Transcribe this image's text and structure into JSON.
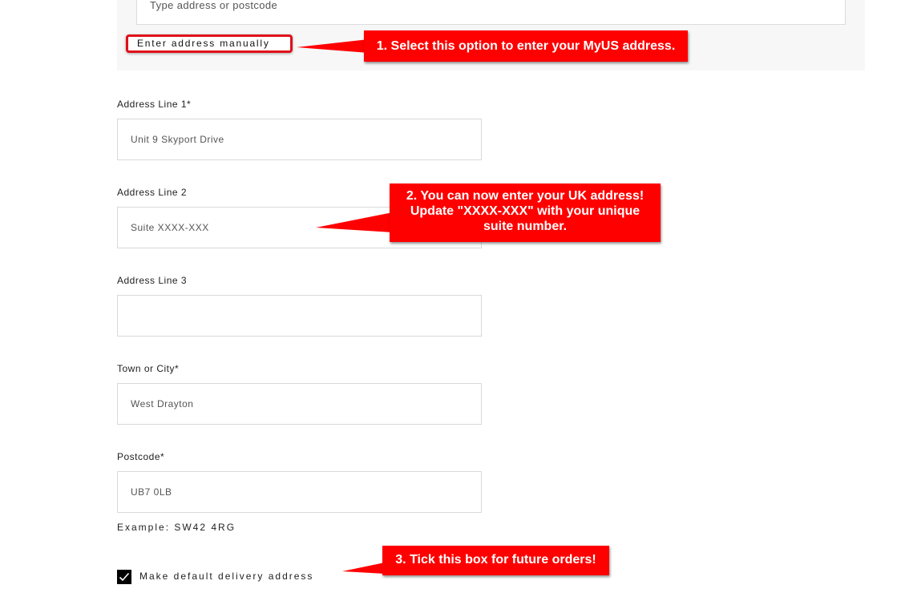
{
  "address_lookup": {
    "placeholder": "Type address or postcode",
    "manual_button_label": "Enter address manually"
  },
  "fields": [
    {
      "label": "Address Line 1*",
      "value": "Unit 9 Skyport Drive"
    },
    {
      "label": "Address Line 2",
      "value": "Suite XXXX-XXX"
    },
    {
      "label": "Address Line 3",
      "value": ""
    },
    {
      "label": "Town or City*",
      "value": "West Drayton"
    },
    {
      "label": "Postcode*",
      "value": "UB7 0LB"
    }
  ],
  "postcode_hint": "Example: SW42 4RG",
  "default_address": {
    "label": "Make default delivery address",
    "checked": true
  },
  "callouts": [
    {
      "text": "1. Select this option to enter your MyUS address."
    },
    {
      "text": "2. You can now enter your UK address! Update \"XXXX-XXX\" with your unique suite number."
    },
    {
      "text": "3.  Tick this box for future orders!"
    }
  ],
  "colors": {
    "callout": "#ff0000",
    "highlight_border": "#e0101a",
    "panel_bg": "#f7f7f7"
  }
}
